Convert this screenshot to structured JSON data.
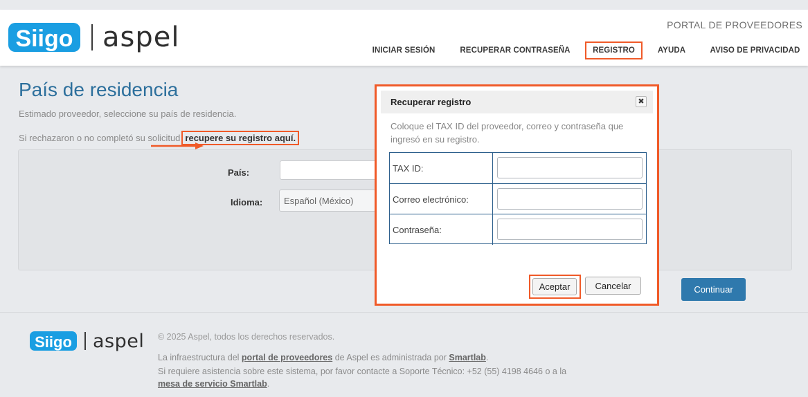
{
  "header": {
    "portal_title": "PORTAL DE PROVEEDORES",
    "logo_siigo_text": "Siigo",
    "logo_aspel_text": "aspel",
    "nav": [
      {
        "label": "INICIAR SESIÓN",
        "highlighted": false
      },
      {
        "label": "RECUPERAR CONTRASEÑA",
        "highlighted": false
      },
      {
        "label": "REGISTRO",
        "highlighted": true
      },
      {
        "label": "AYUDA",
        "highlighted": false
      },
      {
        "label": "AVISO DE PRIVACIDAD",
        "highlighted": false
      }
    ]
  },
  "main": {
    "title": "País de residencia",
    "subtitle": "Estimado proveedor, seleccione su país de residencia.",
    "recover_prefix": "Si rechazaron o no completó su solicitud",
    "recover_link": "recupere su registro aquí",
    "recover_suffix": ".",
    "form": {
      "country_label": "País:",
      "country_value": "",
      "language_label": "Idioma:",
      "language_value": "Español (México)"
    },
    "continue_label": "Continuar"
  },
  "modal": {
    "title": "Recuperar registro",
    "close_symbol": "✖",
    "description": "Coloque el TAX ID del proveedor, correo y contraseña que ingresó en su registro.",
    "fields": [
      {
        "label": "TAX ID:",
        "value": ""
      },
      {
        "label": "Correo electrónico:",
        "value": ""
      },
      {
        "label": "Contraseña:",
        "value": ""
      }
    ],
    "accept_label": "Aceptar",
    "cancel_label": "Cancelar"
  },
  "footer": {
    "copyright": "© 2025 Aspel, todos los derechos reservados.",
    "line1_prefix": "La infraestructura del",
    "line1_link1": "portal de proveedores",
    "line1_middle": "de Aspel es administrada por",
    "line1_link2": "Smartlab",
    "line1_suffix": ".",
    "line2": "Si requiere asistencia sobre este sistema, por favor contacte a Soporte Técnico: +52 (55) 4198 4646 o a la",
    "line3_link": "mesa de servicio Smartlab",
    "line3_suffix": "."
  },
  "colors": {
    "accent_blue": "#2c6f9c",
    "button_blue": "#2f79ad",
    "annotation_orange": "#f05a28",
    "siigo_blue": "#1a9ee2"
  }
}
